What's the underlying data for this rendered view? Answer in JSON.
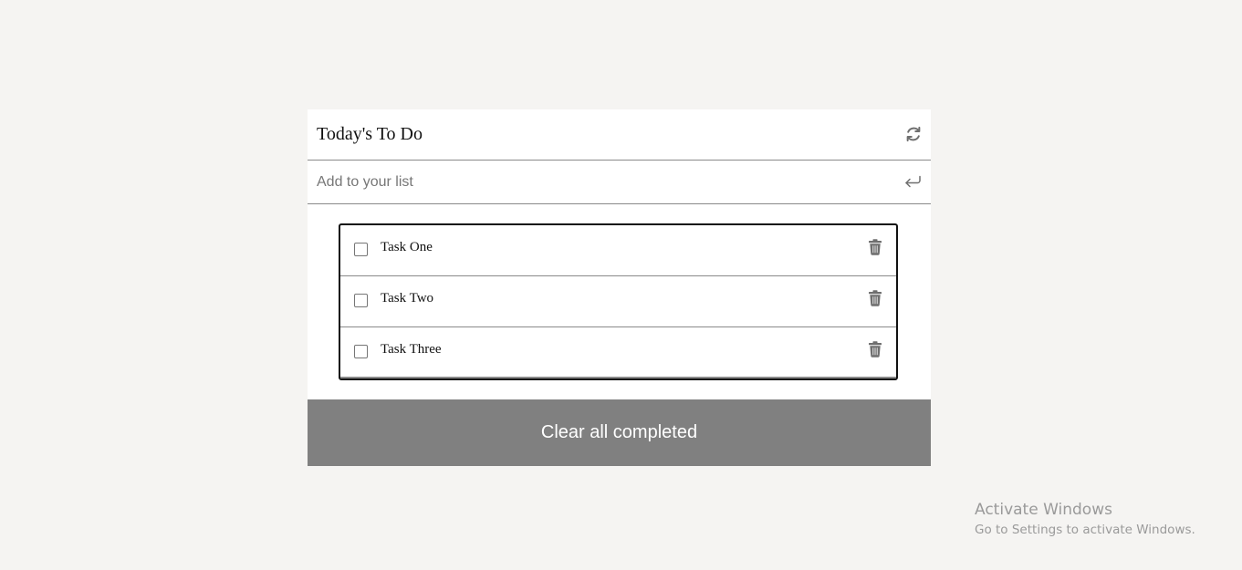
{
  "app": {
    "title": "Today's To Do",
    "refresh_icon": "refresh-icon"
  },
  "input": {
    "placeholder": "Add to your list",
    "value": "",
    "submit_icon": "enter-arrow-icon"
  },
  "tasks": [
    {
      "label": "Task One",
      "completed": false,
      "delete_icon": "trash-icon"
    },
    {
      "label": "Task Two",
      "completed": false,
      "delete_icon": "trash-icon"
    },
    {
      "label": "Task Three",
      "completed": false,
      "delete_icon": "trash-icon"
    }
  ],
  "footer": {
    "clear_label": "Clear all completed"
  },
  "watermark": {
    "title": "Activate Windows",
    "subtitle": "Go to Settings to activate Windows."
  },
  "colors": {
    "page_background": "#f5f4f2",
    "card_background": "#ffffff",
    "button_background": "#808080",
    "button_text": "#ffffff",
    "icon_gray": "#6f6f6f"
  }
}
